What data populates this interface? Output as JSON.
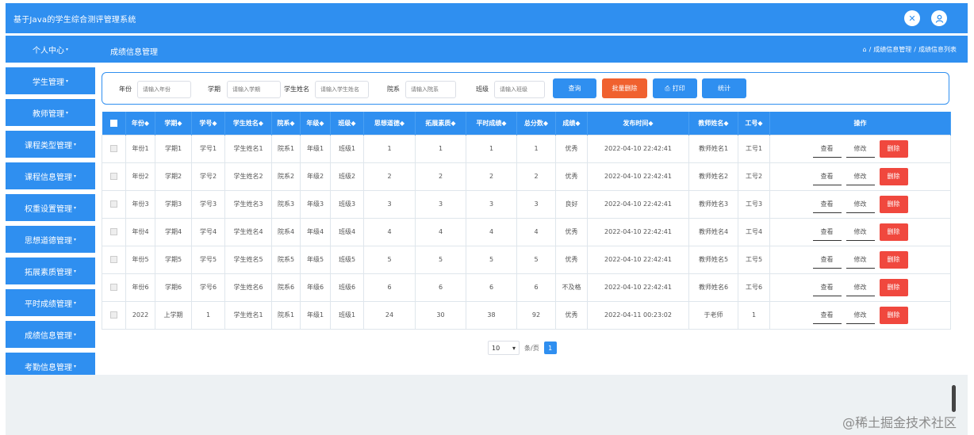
{
  "app": {
    "title": "基于Java的学生综合测评管理系统"
  },
  "header_icons": {
    "left": "close-icon",
    "right": "user-icon"
  },
  "page": {
    "title": "成绩信息管理",
    "breadcrumb": [
      "成绩信息管理",
      "成绩信息列表"
    ],
    "breadcrumb_sep": "/",
    "home_icon": "home-icon"
  },
  "sidebar": {
    "items": [
      {
        "label": "个人中心"
      },
      {
        "label": "学生管理"
      },
      {
        "label": "教师管理"
      },
      {
        "label": "课程类型管理"
      },
      {
        "label": "课程信息管理"
      },
      {
        "label": "权重设置管理"
      },
      {
        "label": "思想道德管理"
      },
      {
        "label": "拓展素质管理"
      },
      {
        "label": "平时成绩管理"
      },
      {
        "label": "成绩信息管理"
      },
      {
        "label": "考勤信息管理"
      }
    ]
  },
  "search": {
    "fields": [
      {
        "label": "年份",
        "placeholder": "请输入年份"
      },
      {
        "label": "学期",
        "placeholder": "请输入学期"
      },
      {
        "label": "学生姓名",
        "placeholder": "请输入学生姓名"
      },
      {
        "label": "院系",
        "placeholder": "请输入院系"
      },
      {
        "label": "班级",
        "placeholder": "请输入班级"
      }
    ],
    "query_label": "查询",
    "batch_delete_label": "批量删除",
    "print_label": "打印",
    "stats_label": "统计"
  },
  "table": {
    "headers": [
      "年份",
      "学期",
      "学号",
      "学生姓名",
      "院系",
      "年级",
      "班级",
      "思想道德",
      "拓展素质",
      "平时成绩",
      "总分数",
      "成绩",
      "发布时间",
      "教师姓名",
      "工号",
      "操作"
    ],
    "sort_glyph": "◆",
    "rows": [
      [
        "年份1",
        "学期1",
        "学号1",
        "学生姓名1",
        "院系1",
        "年级1",
        "班级1",
        "1",
        "1",
        "1",
        "1",
        "优秀",
        "2022-04-10 22:42:41",
        "教师姓名1",
        "工号1"
      ],
      [
        "年份2",
        "学期2",
        "学号2",
        "学生姓名2",
        "院系2",
        "年级2",
        "班级2",
        "2",
        "2",
        "2",
        "2",
        "优秀",
        "2022-04-10 22:42:41",
        "教师姓名2",
        "工号2"
      ],
      [
        "年份3",
        "学期3",
        "学号3",
        "学生姓名3",
        "院系3",
        "年级3",
        "班级3",
        "3",
        "3",
        "3",
        "3",
        "良好",
        "2022-04-10 22:42:41",
        "教师姓名3",
        "工号3"
      ],
      [
        "年份4",
        "学期4",
        "学号4",
        "学生姓名4",
        "院系4",
        "年级4",
        "班级4",
        "4",
        "4",
        "4",
        "4",
        "优秀",
        "2022-04-10 22:42:41",
        "教师姓名4",
        "工号4"
      ],
      [
        "年份5",
        "学期5",
        "学号5",
        "学生姓名5",
        "院系5",
        "年级5",
        "班级5",
        "5",
        "5",
        "5",
        "5",
        "优秀",
        "2022-04-10 22:42:41",
        "教师姓名5",
        "工号5"
      ],
      [
        "年份6",
        "学期6",
        "学号6",
        "学生姓名6",
        "院系6",
        "年级6",
        "班级6",
        "6",
        "6",
        "6",
        "6",
        "不及格",
        "2022-04-10 22:42:41",
        "教师姓名6",
        "工号6"
      ],
      [
        "2022",
        "上学期",
        "1",
        "学生姓名1",
        "院系1",
        "年级1",
        "班级1",
        "24",
        "30",
        "38",
        "92",
        "优秀",
        "2022-04-11 00:23:02",
        "于老师",
        "1"
      ]
    ],
    "actions": {
      "view": "查看",
      "edit": "修改",
      "delete": "删除"
    }
  },
  "pagination": {
    "page_size": "10",
    "per_page_suffix": "条/页",
    "current_page": "1"
  },
  "watermark": "@稀土掘金技术社区",
  "colors": {
    "primary": "#2f8ff0",
    "danger": "#f0483e",
    "grey_bg": "#edf1f3"
  }
}
